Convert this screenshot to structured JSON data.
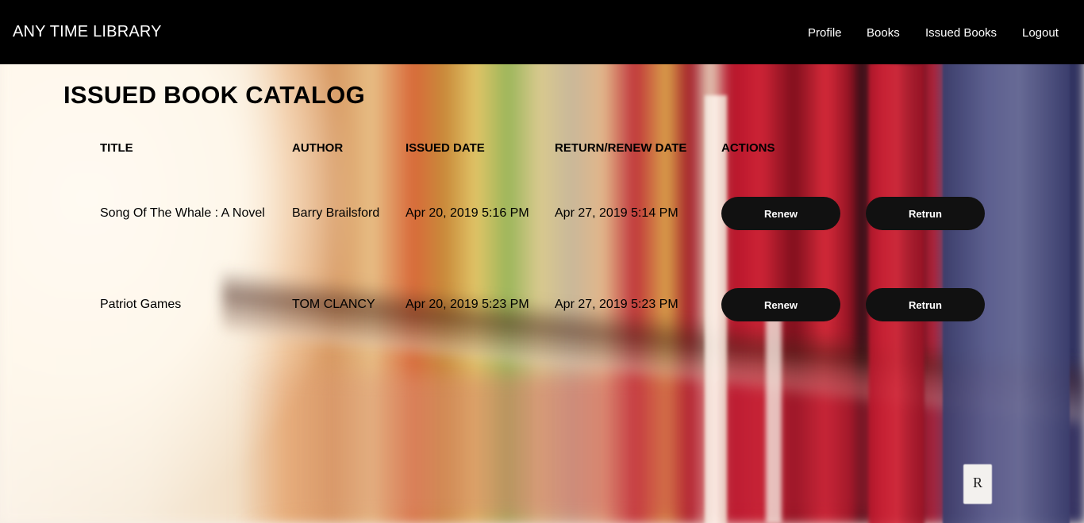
{
  "navbar": {
    "brand": "ANY TIME LIBRARY",
    "links": [
      {
        "label": "Profile"
      },
      {
        "label": "Books"
      },
      {
        "label": "Issued Books"
      },
      {
        "label": "Logout"
      }
    ]
  },
  "main": {
    "title": "ISSUED BOOK CATALOG",
    "table": {
      "columns": [
        "TITLE",
        "AUTHOR",
        "ISSUED DATE",
        "RETURN/RENEW DATE",
        "ACTIONS"
      ],
      "rows": [
        {
          "title": "Song Of The Whale : A Novel",
          "author": "Barry Brailsford",
          "issued_date": "Apr 20, 2019 5:16 PM",
          "return_date": "Apr 27, 2019 5:14 PM",
          "renew_label": "Renew",
          "return_label": "Retrun"
        },
        {
          "title": "Patriot Games",
          "author": "TOM CLANCY",
          "issued_date": "Apr 20, 2019 5:23 PM",
          "return_date": "Apr 27, 2019 5:23 PM",
          "renew_label": "Renew",
          "return_label": "Retrun"
        }
      ]
    }
  },
  "background": {
    "shelf_label": "R"
  },
  "colors": {
    "navbar_bg": "#000000",
    "button_bg": "#111111",
    "button_text": "#ffffff",
    "text": "#000000"
  }
}
